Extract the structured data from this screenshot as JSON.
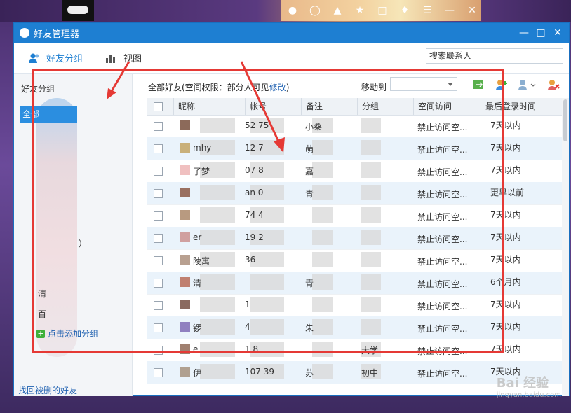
{
  "window": {
    "title": "好友管理器"
  },
  "toolbar": {
    "tab_friends": "好友分组",
    "tab_view": "视图",
    "search_placeholder": "搜索联系人"
  },
  "left": {
    "title": "好友分组",
    "all_button": "全部",
    "items": [
      "）",
      "清",
      "百"
    ],
    "add_group": "点击添加分组",
    "recover": "找回被删的好友"
  },
  "main": {
    "header_prefix": "全部好友(空间权限：部分人可见",
    "header_link": "修改",
    "header_suffix": ")",
    "move_to": "移动到",
    "columns": [
      "昵称",
      "帐号",
      "备注",
      "分组",
      "空间访问",
      "最后登录时间"
    ]
  },
  "rows": [
    {
      "nick": "",
      "acct": "52   75",
      "note": "小桑",
      "group": "",
      "space": "禁止访问空...",
      "last": "7天以内",
      "avatar": "#8c6a5a"
    },
    {
      "nick": "mhy",
      "acct": "12   7",
      "note": "萌",
      "group": "",
      "space": "禁止访问空...",
      "last": "7天以内",
      "avatar": "#c9b07a"
    },
    {
      "nick": "了梦",
      "acct": "07   8",
      "note": "嘉",
      "group": "",
      "space": "禁止访问空...",
      "last": "7天以内",
      "avatar": "#f0c0c0"
    },
    {
      "nick": "",
      "acct": "an   0",
      "note": "青",
      "group": "",
      "space": "禁止访问空...",
      "last": "更早以前",
      "avatar": "#9a7060"
    },
    {
      "nick": "",
      "acct": "74   4",
      "note": "",
      "group": "",
      "space": "禁止访问空...",
      "last": "7天以内",
      "avatar": "#b89a80"
    },
    {
      "nick": "er",
      "acct": "19   2",
      "note": "",
      "group": "",
      "space": "禁止访问空...",
      "last": "7天以内",
      "avatar": "#d0a0a0"
    },
    {
      "nick": "陵寓",
      "acct": "   36",
      "note": "",
      "group": "",
      "space": "禁止访问空...",
      "last": "7天以内",
      "avatar": "#b8a090"
    },
    {
      "nick": "清",
      "acct": "",
      "note": "青",
      "group": "",
      "space": "禁止访问空...",
      "last": "6个月内",
      "avatar": "#c08070"
    },
    {
      "nick": "",
      "acct": "   1",
      "note": "",
      "group": "",
      "space": "禁止访问空...",
      "last": "7天以内",
      "avatar": "#8a6a60"
    },
    {
      "nick": "锣",
      "acct": "   4",
      "note": "朱",
      "group": "",
      "space": "禁止访问空...",
      "last": "7天以内",
      "avatar": "#9080c0"
    },
    {
      "nick": "e",
      "acct": "1   8",
      "note": "",
      "group": "大学",
      "space": "禁止访问空...",
      "last": "7天以内",
      "avatar": "#a08070"
    },
    {
      "nick": "伊",
      "acct": "107   39",
      "note": "苏",
      "group": "初中",
      "space": "禁止访问空...",
      "last": "7天以内",
      "avatar": "#b0a090"
    }
  ],
  "watermark": {
    "text": "Bai 经验",
    "sub": "jingyan.baidu.com"
  },
  "colors": {
    "titlebar": "#1e7fd2",
    "accent": "#1e7fd2",
    "highlight_row": "#eaf3fb",
    "annotation": "#e53935"
  }
}
